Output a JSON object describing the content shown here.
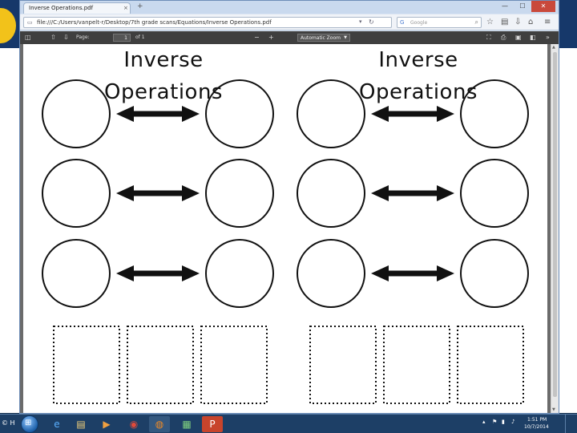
{
  "browser": {
    "tab_title": "Inverse Operations.pdf",
    "tab_close": "×",
    "new_tab": "+",
    "window_controls": {
      "minimize": "—",
      "maximize": "☐",
      "close": "✕"
    },
    "url": "file:///C:/Users/vanpelt-r/Desktop/7th grade scans/Equations/Inverse Operations.pdf",
    "search_engine": "Google",
    "nav_icons": [
      "star-icon",
      "reading-list-icon",
      "download-icon",
      "home-icon",
      "menu-icon"
    ]
  },
  "pdf_toolbar": {
    "page_label": "Page:",
    "page_value": "1",
    "page_count": "of 1",
    "zoom_value": "Automatic Zoom",
    "zoom_out": "−",
    "zoom_in": "+"
  },
  "worksheet": {
    "title_left": "Inverse Operations",
    "title_right": "Inverse Operations",
    "arrow_rows": 3,
    "blank_boxes_per_half": 3
  },
  "taskbar": {
    "corner_text": "© H",
    "apps": [
      "windows-explorer-icon",
      "internet-explorer-icon",
      "file-explorer-icon",
      "media-player-icon",
      "chrome-icon",
      "firefox-icon",
      "app-icon",
      "powerpoint-icon"
    ],
    "clock_time": "1:51 PM",
    "clock_date": "10/7/2014"
  },
  "colors": {
    "taskbar": "#1d3f66",
    "pdf_toolbar": "#3f3f3f",
    "ink": "#111111",
    "close_button": "#c9493b"
  }
}
